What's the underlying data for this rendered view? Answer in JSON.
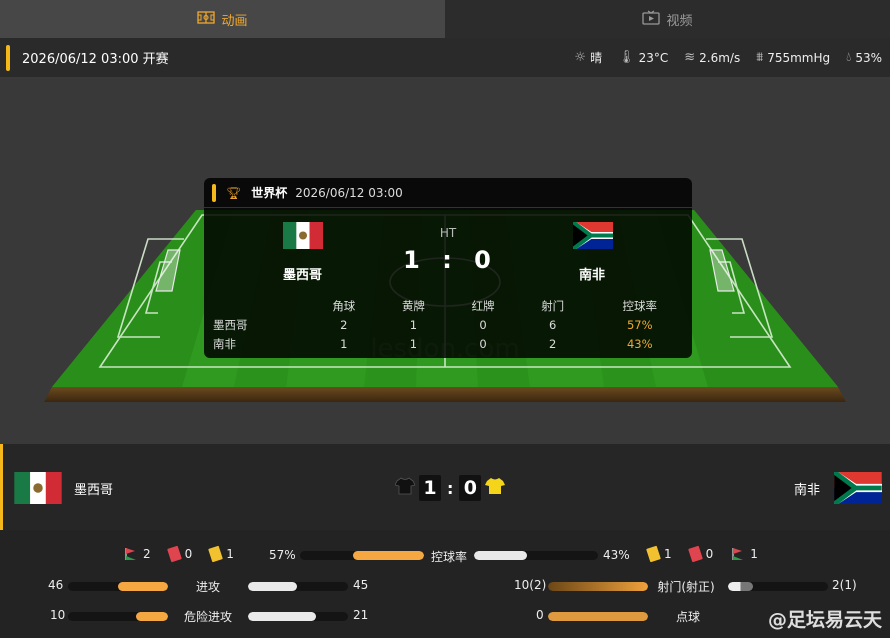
{
  "tabs": [
    {
      "label": "动画",
      "icon": "pitch-icon",
      "active": true
    },
    {
      "label": "视频",
      "icon": "tv-icon",
      "active": false
    }
  ],
  "match": {
    "start_text": "2026/06/12 03:00 开赛",
    "competition": "世界杯",
    "datetime": "2026/06/12 03:00",
    "status": "HT",
    "home": {
      "name": "墨西哥",
      "score": "1"
    },
    "away": {
      "name": "南非",
      "score": "0"
    },
    "score_sep": ":"
  },
  "weather": {
    "condition": "晴",
    "temperature": "23°C",
    "wind": "2.6m/s",
    "pressure": "755mmHg",
    "humidity": "53%"
  },
  "summary_table": {
    "headers": [
      "角球",
      "黄牌",
      "红牌",
      "射门",
      "控球率"
    ],
    "rows": [
      {
        "team": "墨西哥",
        "values": [
          "2",
          "1",
          "0",
          "6",
          "57%"
        ]
      },
      {
        "team": "南非",
        "values": [
          "1",
          "1",
          "0",
          "2",
          "43%"
        ]
      }
    ]
  },
  "stats": {
    "home_corners": "2",
    "home_red": "0",
    "home_yellow": "1",
    "away_yellow": "1",
    "away_red": "0",
    "away_corners": "1",
    "possession": {
      "label": "控球率",
      "home": "57%",
      "away": "43%",
      "home_frac": 0.57,
      "away_frac": 0.43
    },
    "attack": {
      "label": "进攻",
      "home": "46",
      "away": "45"
    },
    "dangerous_attack": {
      "label": "危险进攻",
      "home": "10",
      "away": "21"
    },
    "shots": {
      "label": "射门(射正)",
      "home": "10(2)",
      "away": "2(1)"
    },
    "penalties": {
      "label": "点球",
      "home": "0",
      "away": "0"
    }
  },
  "watermark": "@足坛易云天",
  "colors": {
    "accent": "#f5b81a",
    "orange": "#f5a742",
    "grass": "#2f9a1f"
  }
}
